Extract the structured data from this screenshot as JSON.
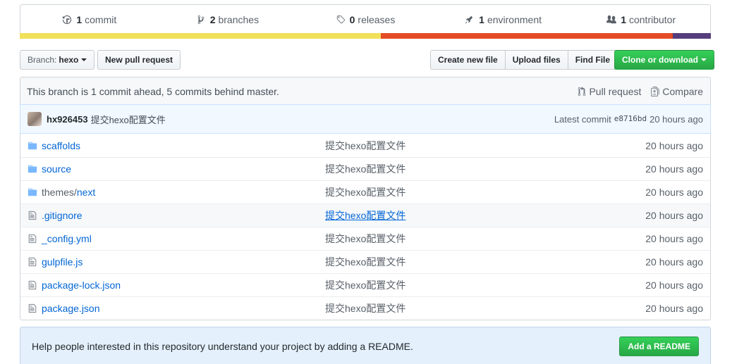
{
  "summary": {
    "commits": {
      "count": "1",
      "label": "commit"
    },
    "branches": {
      "count": "2",
      "label": "branches"
    },
    "releases": {
      "count": "0",
      "label": "releases"
    },
    "environments": {
      "count": "1",
      "label": "environment"
    },
    "contributors": {
      "count": "1",
      "label": "contributor"
    }
  },
  "language_bar": [
    {
      "color": "#f1e05a",
      "percent": 52.2
    },
    {
      "color": "#e34c26",
      "percent": 42.3
    },
    {
      "color": "#563d7c",
      "percent": 5.5
    }
  ],
  "toolbar": {
    "branch_prefix": "Branch:",
    "branch_name": "hexo",
    "new_pr": "New pull request",
    "create_file": "Create new file",
    "upload_files": "Upload files",
    "find_file": "Find File",
    "clone": "Clone or download"
  },
  "branch_info": {
    "text": "This branch is 1 commit ahead, 5 commits behind master.",
    "pull_request": "Pull request",
    "compare": "Compare"
  },
  "latest_commit": {
    "author": "hx926453",
    "message": "提交hexo配置文件",
    "prefix": "Latest commit",
    "sha": "e8716bd",
    "age": "20 hours ago"
  },
  "files": [
    {
      "type": "dir",
      "name": "scaffolds",
      "message": "提交hexo配置文件",
      "age": "20 hours ago"
    },
    {
      "type": "dir",
      "name": "source",
      "message": "提交hexo配置文件",
      "age": "20 hours ago"
    },
    {
      "type": "dir",
      "name_dim": "themes/",
      "name": "next",
      "message": "提交hexo配置文件",
      "age": "20 hours ago"
    },
    {
      "type": "file",
      "name": ".gitignore",
      "message": "提交hexo配置文件",
      "age": "20 hours ago"
    },
    {
      "type": "file",
      "name": "_config.yml",
      "message": "提交hexo配置文件",
      "age": "20 hours ago"
    },
    {
      "type": "file",
      "name": "gulpfile.js",
      "message": "提交hexo配置文件",
      "age": "20 hours ago"
    },
    {
      "type": "file",
      "name": "package-lock.json",
      "message": "提交hexo配置文件",
      "age": "20 hours ago"
    },
    {
      "type": "file",
      "name": "package.json",
      "message": "提交hexo配置文件",
      "age": "20 hours ago"
    }
  ],
  "readme": {
    "text": "Help people interested in this repository understand your project by adding a README.",
    "button": "Add a README"
  },
  "icons": {
    "commits": "history-icon",
    "branches": "git-branch-icon",
    "releases": "tag-icon",
    "environment": "rocket-icon",
    "contributors": "people-icon",
    "directory": "file-directory-icon",
    "file": "file-icon",
    "pull_request": "git-pull-request-icon",
    "compare": "diff-icon"
  }
}
